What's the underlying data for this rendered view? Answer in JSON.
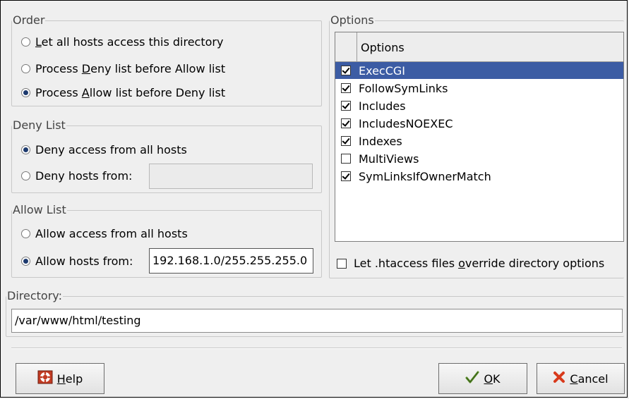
{
  "order": {
    "legend": "Order",
    "options": [
      {
        "pre": "",
        "key": "L",
        "post": "et all hosts access this directory",
        "selected": false
      },
      {
        "pre": "Process ",
        "key": "D",
        "post": "eny list before Allow list",
        "selected": false
      },
      {
        "pre": "Process ",
        "key": "A",
        "post": "llow list before Deny list",
        "selected": true
      }
    ]
  },
  "deny_list": {
    "legend": "Deny List",
    "all_label": "Deny access from all hosts",
    "all_selected": true,
    "from_label": "Deny hosts from:",
    "from_selected": false,
    "from_value": ""
  },
  "allow_list": {
    "legend": "Allow List",
    "all_label": "Allow access from all hosts",
    "all_selected": false,
    "from_label": "Allow hosts from:",
    "from_selected": true,
    "from_value": "192.168.1.0/255.255.255.0"
  },
  "options": {
    "legend": "Options",
    "column_header": "Options",
    "items": [
      {
        "label": "ExecCGI",
        "checked": true,
        "selected": true
      },
      {
        "label": "FollowSymLinks",
        "checked": true,
        "selected": false
      },
      {
        "label": "Includes",
        "checked": true,
        "selected": false
      },
      {
        "label": "IncludesNOEXEC",
        "checked": true,
        "selected": false
      },
      {
        "label": "Indexes",
        "checked": true,
        "selected": false
      },
      {
        "label": "MultiViews",
        "checked": false,
        "selected": false
      },
      {
        "label": "SymLinksIfOwnerMatch",
        "checked": true,
        "selected": false
      }
    ],
    "htaccess": {
      "pre": "Let .htaccess files ",
      "key": "o",
      "post": "verride directory options",
      "checked": false
    }
  },
  "directory": {
    "legend": "Directory:",
    "value": "/var/www/html/testing"
  },
  "buttons": {
    "help": {
      "key": "H",
      "rest": "elp",
      "icon": "lifebuoy-icon"
    },
    "ok": {
      "key": "O",
      "rest": "K",
      "icon": "checkmark-icon"
    },
    "cancel": {
      "key": "C",
      "rest": "ancel",
      "icon": "x-icon"
    }
  },
  "colors": {
    "selection": "#3c5ca4",
    "cancel_icon": "#d83a1c",
    "ok_icon": "#5a8f2a"
  }
}
